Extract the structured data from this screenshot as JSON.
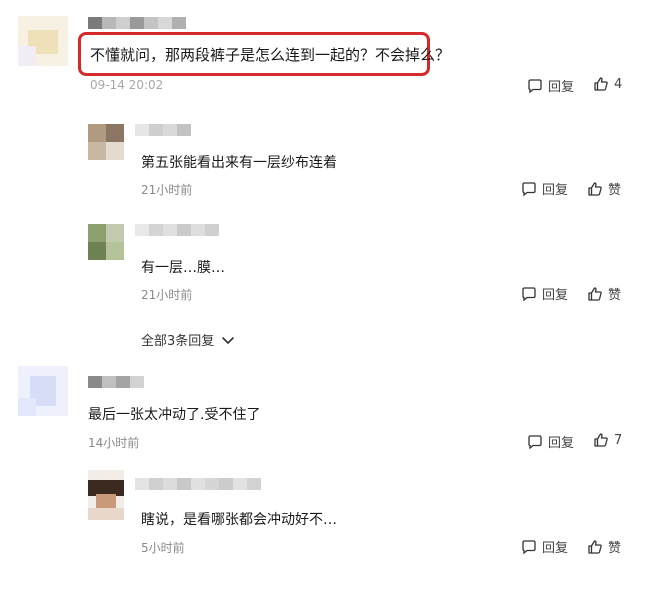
{
  "comments": [
    {
      "text": "不懂就问，那两段裤子是怎么连到一起的？不会掉么？",
      "time": "09-14 20:02",
      "reply_label": "回复",
      "like_label": "4"
    },
    {
      "text": "最后一张太冲动了.受不住了",
      "time": "14小时前",
      "reply_label": "回复",
      "like_label": "7"
    }
  ],
  "replies": [
    {
      "text": "第五张能看出来有一层纱布连着",
      "time": "21小时前",
      "reply_label": "回复",
      "like_label": "赞"
    },
    {
      "text": "有一层…膜…",
      "time": "21小时前",
      "reply_label": "回复",
      "like_label": "赞"
    },
    {
      "text": "瞎说，是看哪张都会冲动好不…",
      "time": "5小时前",
      "reply_label": "回复",
      "like_label": "赞"
    }
  ],
  "show_all_replies": "全部3条回复",
  "colors": {
    "highlight_border": "#d42a2a",
    "time_text": "#8a8a8a"
  }
}
